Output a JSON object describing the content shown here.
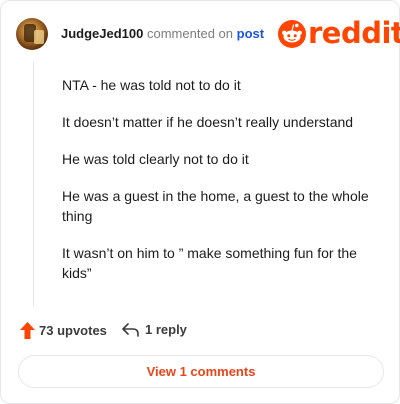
{
  "header": {
    "username": "JudgeJed100",
    "action_text": "commented on",
    "post_link": "post",
    "logo_text": "reddit"
  },
  "comment": {
    "paragraphs": [
      "NTA - he was told not to do it",
      "It doesn’t matter if he doesn’t really understand",
      "He was told clearly not to do it",
      "He was a guest in the home, a guest to the whole thing",
      "It wasn’t on him to ” make something fun for the kids”"
    ]
  },
  "actions": {
    "upvotes_label": "73 upvotes",
    "reply_label": "1 reply"
  },
  "footer": {
    "view_comments_label": "View 1 comments"
  },
  "colors": {
    "brand": "#ff4500",
    "link": "#1a56db",
    "view_button_text": "#e8461b"
  },
  "icons": [
    "upvote-arrow-icon",
    "reply-arrow-icon",
    "reddit-snoo-icon"
  ]
}
